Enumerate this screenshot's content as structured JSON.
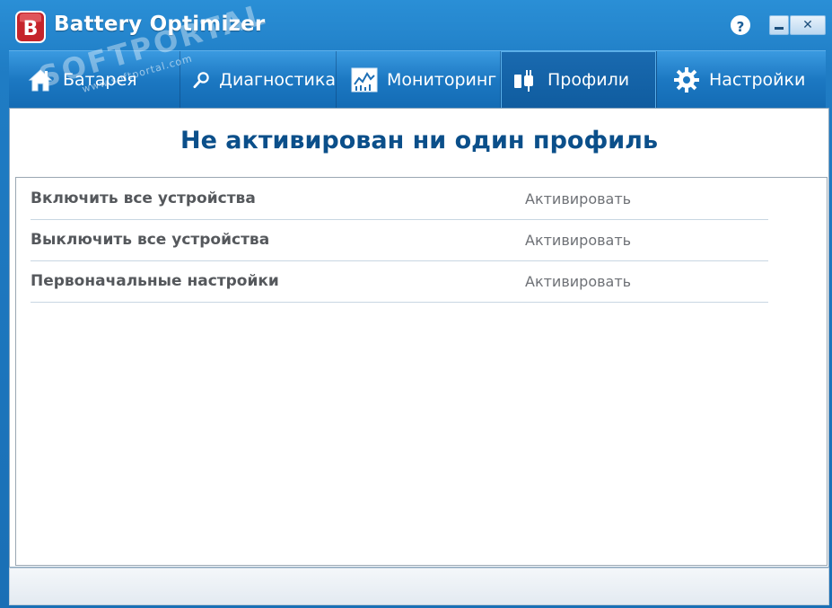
{
  "window": {
    "title": "Battery Optimizer",
    "help_label": "?",
    "close_label": "✕",
    "logo_letter": "B"
  },
  "tabs": [
    {
      "label": "Батарея",
      "icon": "home-icon"
    },
    {
      "label": "Диагностика",
      "icon": "magnifier-icon"
    },
    {
      "label": "Мониторинг",
      "icon": "chart-monitor-icon"
    },
    {
      "label": "Профили",
      "icon": "plug-icon",
      "active": true
    },
    {
      "label": "Настройки",
      "icon": "gear-icon"
    }
  ],
  "main": {
    "headline": "Не активирован ни один профиль",
    "profiles": [
      {
        "name": "Включить все устройства",
        "action": "Активировать"
      },
      {
        "name": "Выключить все устройства",
        "action": "Активировать"
      },
      {
        "name": "Первоначальные настройки",
        "action": "Активировать"
      }
    ]
  },
  "watermark": {
    "text": "SOFTPORTAL",
    "url": "www.softportal.com"
  },
  "colors": {
    "titlebar_blue": "#1f7cc4",
    "headline_blue": "#0b4f8a",
    "row_text": "#55585c"
  }
}
